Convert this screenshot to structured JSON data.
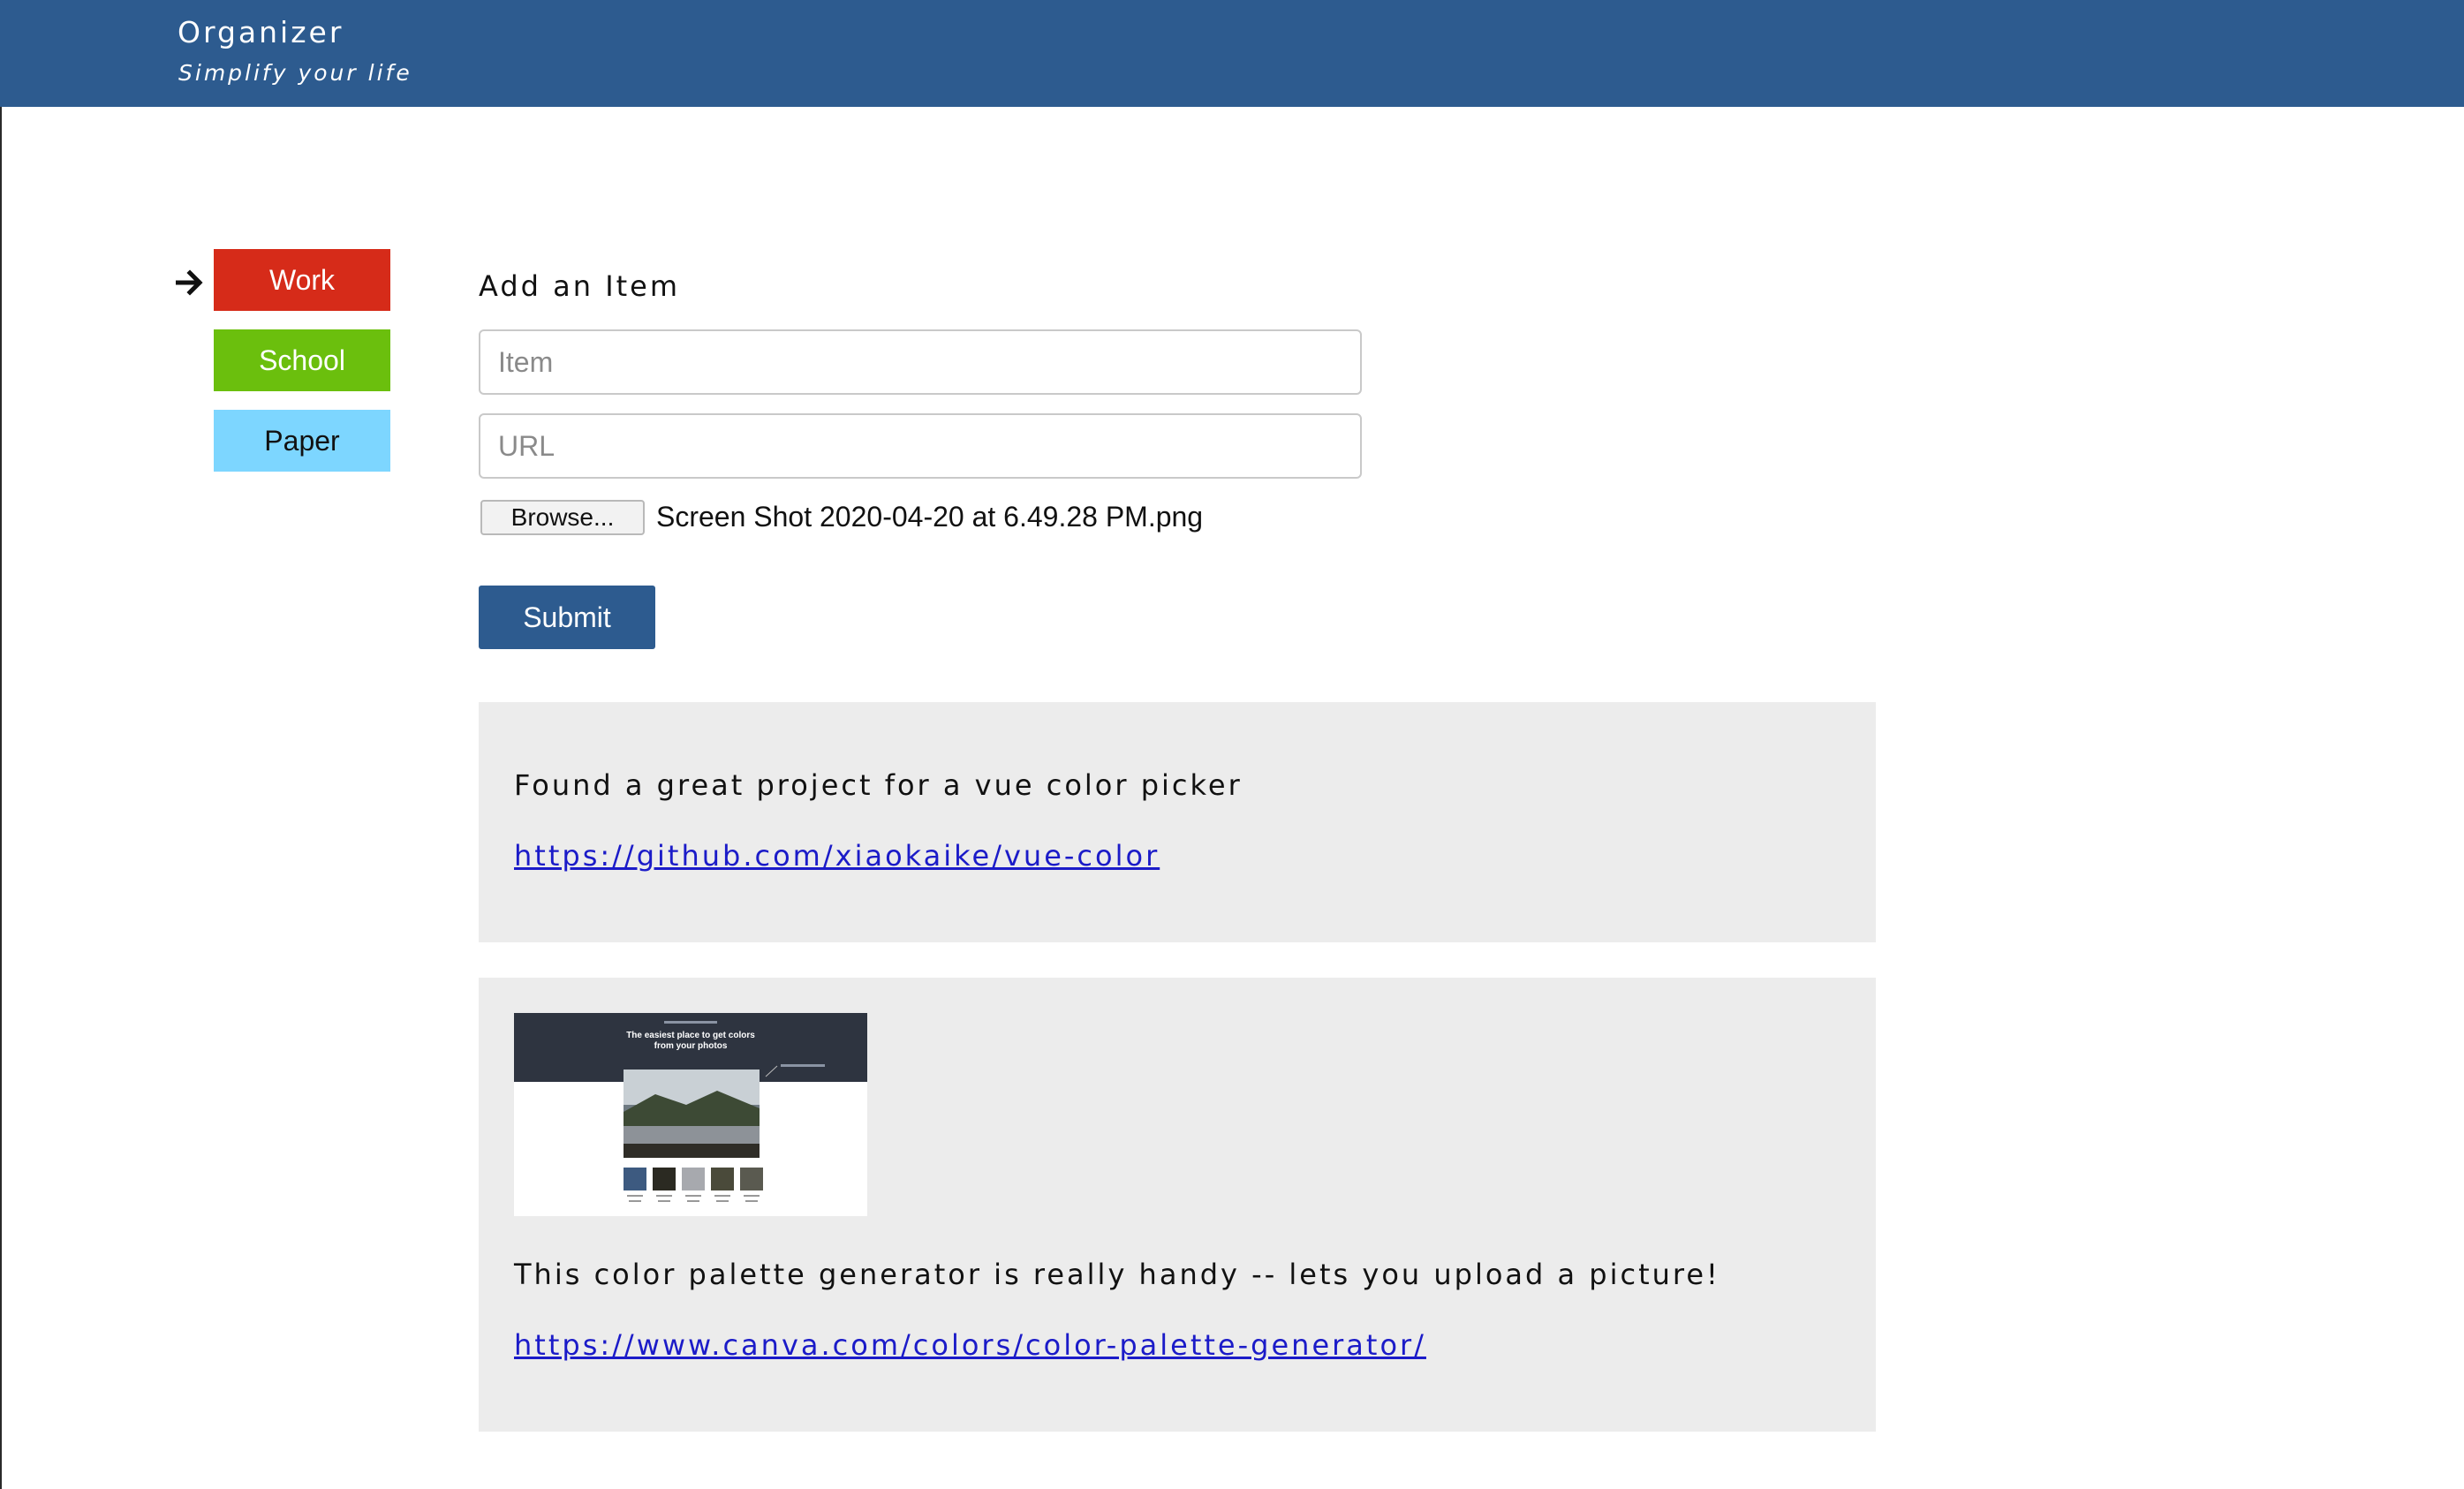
{
  "header": {
    "title": "Organizer",
    "tagline": "Simplify your life"
  },
  "sidebar": {
    "items": [
      {
        "label": "Work",
        "color": "#d62b19",
        "selected": true
      },
      {
        "label": "School",
        "color": "#6bbf0d",
        "selected": false
      },
      {
        "label": "Paper",
        "color": "#7dd6ff",
        "selected": false
      }
    ],
    "selected_indicator_icon": "arrow-right-icon"
  },
  "form": {
    "heading": "Add an Item",
    "item_placeholder": "Item",
    "url_placeholder": "URL",
    "browse_label": "Browse...",
    "file_name": "Screen Shot 2020-04-20 at 6.49.28 PM.png",
    "submit_label": "Submit"
  },
  "items": [
    {
      "text": "Found a great project for a vue color picker",
      "url": "https://github.com/xiaokaike/vue-color"
    },
    {
      "thumbnail": {
        "heading": "The easiest place to get colors from your photos",
        "swatches": [
          "#3d5a80",
          "#2b2a22",
          "#a7a9ae",
          "#4a4a3a",
          "#5a5a50"
        ]
      },
      "text": "This color palette generator is really handy -- lets you upload a picture!",
      "url": "https://www.canva.com/colors/color-palette-generator/"
    }
  ],
  "colors": {
    "brand": "#2d5b8f",
    "card_bg": "#ececec",
    "link": "#1b1bc8"
  }
}
